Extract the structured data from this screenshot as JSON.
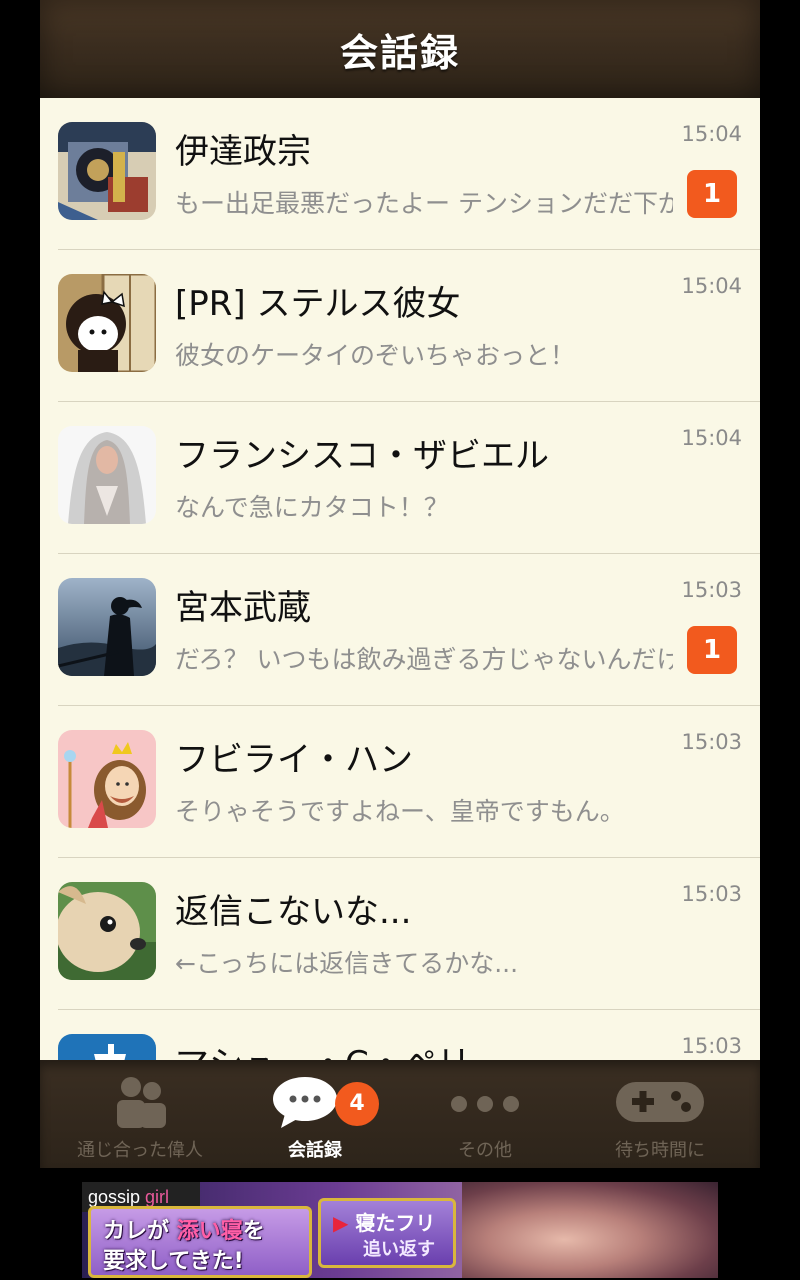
{
  "header": {
    "title": "会話録"
  },
  "conversations": [
    {
      "name": "伊達政宗",
      "message": "もー出足最悪だったよー テンションだだ下がり",
      "time": "15:04",
      "unread": "1",
      "avatar_icon": "samurai-armor-avatar"
    },
    {
      "name": "[PR] ステルス彼女",
      "message": "彼女のケータイのぞいちゃおっと！",
      "time": "15:04",
      "unread": null,
      "avatar_icon": "stealth-girlfriend-avatar"
    },
    {
      "name": "フランシスコ・ザビエル",
      "message": "なんで急にカタコト！？",
      "time": "15:04",
      "unread": null,
      "avatar_icon": "veiled-statue-avatar"
    },
    {
      "name": "宮本武蔵",
      "message": "だろ？ いつもは飲み過ぎる方じゃないんだけど",
      "time": "15:03",
      "unread": "1",
      "avatar_icon": "swordsman-silhouette-avatar"
    },
    {
      "name": "フビライ・ハン",
      "message": "そりゃそうですよねー、皇帝ですもん。",
      "time": "15:03",
      "unread": null,
      "avatar_icon": "crowned-king-avatar"
    },
    {
      "name": "返信こないな...",
      "message": "←こっちには返信きてるかな...",
      "time": "15:03",
      "unread": null,
      "avatar_icon": "chihuahua-avatar"
    },
    {
      "name": "マシュー・C・ペリー",
      "message": "",
      "time": "15:03",
      "unread": null,
      "avatar_icon": "ship-avatar"
    }
  ],
  "tabbar": {
    "tabs": [
      {
        "label": "通じ合った偉人",
        "icon": "people-icon"
      },
      {
        "label": "会話録",
        "icon": "chat-bubble-icon",
        "badge": "4"
      },
      {
        "label": "その他",
        "icon": "more-dots-icon"
      },
      {
        "label": "待ち時間に",
        "icon": "gamepad-icon"
      }
    ]
  },
  "ad": {
    "logo_a": "gossip",
    "logo_b": "girl",
    "line1_a": "カレが",
    "line1_b": "添い寝",
    "line1_c": "を",
    "line2": "要求してきた!",
    "btn_arrow": "▶",
    "btn_text": "寝たフリ",
    "btn_sub": "追い返す"
  }
}
